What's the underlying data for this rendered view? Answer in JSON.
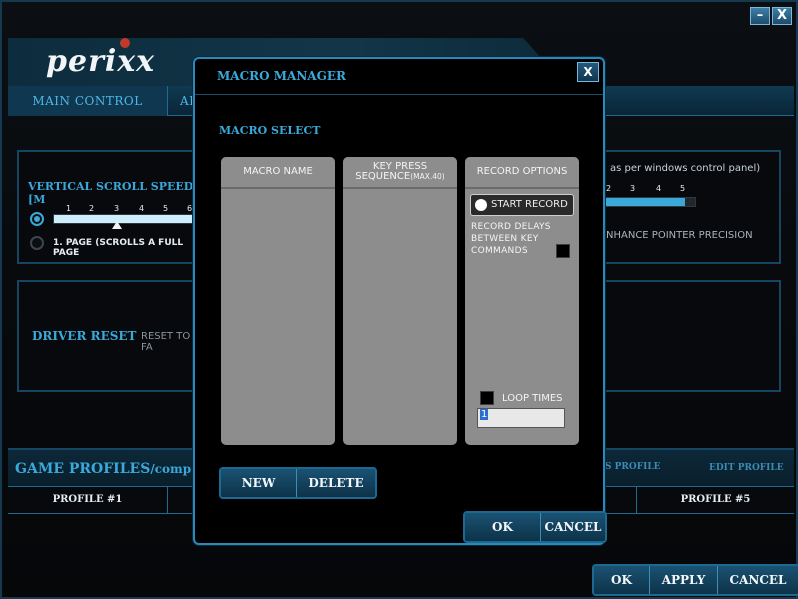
{
  "window": {
    "brand": "perixx",
    "minimize_label": "–",
    "close_label": "X"
  },
  "tabs": [
    {
      "label": "MAIN CONTROL"
    },
    {
      "label": "AI"
    }
  ],
  "scroll_panel": {
    "title": "VERTICAL SCROLL SPEED [M",
    "ticks": [
      "1",
      "2",
      "3",
      "4",
      "5",
      "6"
    ],
    "page_option": "1. PAGE (SCROLLS A FULL PAGE"
  },
  "pointer_panel": {
    "note": "as per windows control panel)",
    "ticks": [
      "2",
      "3",
      "4",
      "5"
    ],
    "precision_label": "NHANCE POINTER PRECISION"
  },
  "driver_panel": {
    "title": "DRIVER RESET",
    "reset_label": "RESET TO FA"
  },
  "game_profiles": {
    "title": "GAME PROFILES",
    "subtitle": "/comp",
    "link_profile": "S PROFILE",
    "edit_profile": "EDIT PROFILE",
    "profile_1": "PROFILE #1",
    "profile_5": "PROFILE #5"
  },
  "footer_buttons": {
    "ok": "OK",
    "apply": "APPLY",
    "cancel": "CANCEL"
  },
  "modal": {
    "title": "MACRO MANAGER",
    "close_label": "X",
    "section": "MACRO SELECT",
    "col_macro_name": "MACRO NAME",
    "col_key_press": "KEY PRESS",
    "col_key_press_seq": "SEQUENCE",
    "col_key_press_max": "(MAX.40)",
    "col_record_options": "RECORD OPTIONS",
    "start_record": "START RECORD",
    "record_delays": "RECORD DELAYS BETWEEN KEY COMMANDS",
    "loop_times_label": "LOOP TIMES",
    "loop_times_value": "1",
    "new_button": "NEW",
    "delete_button": "DELETE",
    "ok_button": "OK",
    "cancel_button": "CANCEL"
  },
  "colors": {
    "accent": "#3aa9da",
    "panel_border": "#154560",
    "modal_column": "#8d8d8d"
  }
}
